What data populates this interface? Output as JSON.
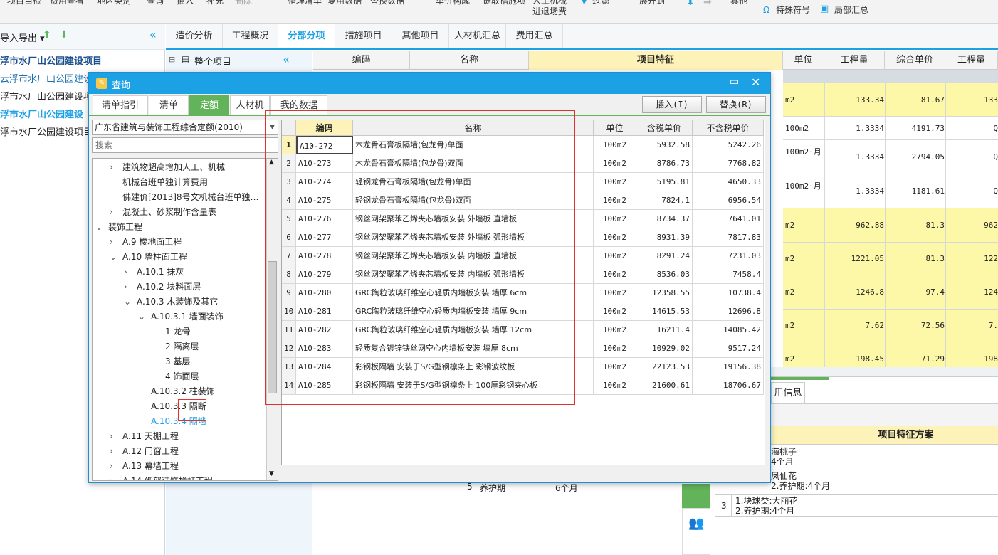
{
  "toolbar": {
    "items": [
      "项目自检",
      "费用查看",
      "地区类别",
      "查询",
      "插入",
      "补充",
      "删除",
      "整理清单",
      "复用数据",
      "替换数据",
      "单价构成",
      "提取措施项",
      "人工机械",
      "进退场费",
      "过滤",
      "展开到",
      "其他",
      "特殊符号",
      "局部汇总"
    ]
  },
  "left": {
    "import_export": "导入导出",
    "projects": [
      {
        "label": "浮市水厂山公园建设项目",
        "bold": true,
        "color": "#1a4f8c"
      },
      {
        "label": "云浮市水厂山公园建设",
        "bold": false,
        "color": "#1a6fb0"
      },
      {
        "label": "浮市水厂山公园建设项",
        "bold": false,
        "color": "#222"
      },
      {
        "label": "浮市水厂山公园建设",
        "bold": true,
        "color": "#1da1e5"
      },
      {
        "label": "浮市水厂公园建设项目",
        "bold": false,
        "color": "#222"
      }
    ]
  },
  "main_tabs": [
    "造价分析",
    "工程概况",
    "分部分项",
    "措施项目",
    "其他项目",
    "人材机汇总",
    "费用汇总"
  ],
  "active_main_tab": "分部分项",
  "midtree": {
    "root": "整个项目"
  },
  "main_header": [
    "编码",
    "名称",
    "项目特征",
    "单位",
    "工程量",
    "综合单价",
    "工程量"
  ],
  "main_rows": [
    {
      "unit": "m2",
      "qty": "133.34",
      "price": "81.67",
      "extra": "133",
      "hl": true
    },
    {
      "unit": "100m2",
      "qty": "1.3334",
      "price": "4191.73",
      "extra": "Q",
      "hl": false
    },
    {
      "unit": "100m2·月",
      "qty": "1.3334",
      "price": "2794.05",
      "extra": "Q",
      "hl": false
    },
    {
      "unit": "100m2·月",
      "qty": "1.3334",
      "price": "1181.61",
      "extra": "Q",
      "hl": false
    },
    {
      "unit": "m2",
      "qty": "962.88",
      "price": "81.3",
      "extra": "962",
      "hl": true
    },
    {
      "unit": "m2",
      "qty": "1221.05",
      "price": "81.3",
      "extra": "122",
      "hl": true
    },
    {
      "unit": "m2",
      "qty": "1246.8",
      "price": "97.4",
      "extra": "124",
      "hl": true
    },
    {
      "unit": "m2",
      "qty": "7.62",
      "price": "72.56",
      "extra": "7.",
      "hl": true
    },
    {
      "unit": "m2",
      "qty": "198.45",
      "price": "71.29",
      "extra": "198",
      "hl": true
    }
  ],
  "lower": {
    "tab_info": "用信息",
    "scheme_header": "项目特征方案",
    "frag1": "海桃子",
    "frag2": "4个月",
    "frag3": "凤仙花",
    "frag4": "2.养护期:4个月",
    "row3_no": "3",
    "row3_a": "1.块球类:大丽花",
    "row3_b": "2.养护期:4个月",
    "bottom_no": "5",
    "bottom_label": "养护期",
    "bottom_val": "6个月"
  },
  "dialog": {
    "title": "查询",
    "tabs": [
      "清单指引",
      "清单",
      "定额",
      "人材机",
      "我的数据"
    ],
    "active_tab": "定额",
    "insert_btn": "插入(I)",
    "replace_btn": "替换(R)",
    "quota_select": "广东省建筑与装饰工程综合定额(2010)",
    "search_placeholder": "搜索",
    "tree": [
      {
        "label": "建筑物超高增加人工、机械",
        "level": 1,
        "arrow": ">"
      },
      {
        "label": "机械台班单独计算费用",
        "level": 1,
        "arrow": ""
      },
      {
        "label": "佛建价[2013]8号文机械台班单独…",
        "level": 1,
        "arrow": ""
      },
      {
        "label": "混凝土、砂浆制作含量表",
        "level": 1,
        "arrow": ">"
      },
      {
        "label": "装饰工程",
        "level": 0,
        "arrow": "v"
      },
      {
        "label": "A.9 楼地面工程",
        "level": 1,
        "arrow": ">"
      },
      {
        "label": "A.10 墙柱面工程",
        "level": 1,
        "arrow": "v"
      },
      {
        "label": "A.10.1 抹灰",
        "level": 2,
        "arrow": ">"
      },
      {
        "label": "A.10.2 块料面层",
        "level": 2,
        "arrow": ">"
      },
      {
        "label": "A.10.3 木装饰及其它",
        "level": 2,
        "arrow": "v"
      },
      {
        "label": "A.10.3.1 墙面装饰",
        "level": 3,
        "arrow": "v"
      },
      {
        "label": "1 龙骨",
        "level": 4,
        "arrow": ""
      },
      {
        "label": "2 隔离层",
        "level": 4,
        "arrow": ""
      },
      {
        "label": "3 基层",
        "level": 4,
        "arrow": ""
      },
      {
        "label": "4 饰面层",
        "level": 4,
        "arrow": ""
      },
      {
        "label": "A.10.3.2 柱装饰",
        "level": 3,
        "arrow": ""
      },
      {
        "label": "A.10.3.3 隔断",
        "level": 3,
        "arrow": ""
      },
      {
        "label": "A.10.3.4 隔墙",
        "level": 3,
        "arrow": "",
        "selected": true
      },
      {
        "label": "A.11 天棚工程",
        "level": 1,
        "arrow": ">"
      },
      {
        "label": "A.12 门窗工程",
        "level": 1,
        "arrow": ">"
      },
      {
        "label": "A.13 幕墙工程",
        "level": 1,
        "arrow": ">"
      },
      {
        "label": "A.14 细部装饰栏杆工程",
        "level": 1,
        "arrow": ">"
      }
    ],
    "grid_headers": [
      "",
      "编码",
      "名称",
      "单位",
      "含税单价",
      "不含税单价"
    ],
    "grid_rows": [
      {
        "no": "1",
        "code": "A10-272",
        "name": "木龙骨石膏板隔墙(包龙骨)单面",
        "unit": "100m2",
        "p1": "5932.58",
        "p2": "5242.26"
      },
      {
        "no": "2",
        "code": "A10-273",
        "name": "木龙骨石膏板隔墙(包龙骨)双面",
        "unit": "100m2",
        "p1": "8786.73",
        "p2": "7768.82"
      },
      {
        "no": "3",
        "code": "A10-274",
        "name": "轻钢龙骨石膏板隔墙(包龙骨)单面",
        "unit": "100m2",
        "p1": "5195.81",
        "p2": "4650.33"
      },
      {
        "no": "4",
        "code": "A10-275",
        "name": "轻钢龙骨石膏板隔墙(包龙骨)双面",
        "unit": "100m2",
        "p1": "7824.1",
        "p2": "6956.54"
      },
      {
        "no": "5",
        "code": "A10-276",
        "name": "钢丝网架聚苯乙烯夹芯墙板安装 外墙板 直墙板",
        "unit": "100m2",
        "p1": "8734.37",
        "p2": "7641.01"
      },
      {
        "no": "6",
        "code": "A10-277",
        "name": "钢丝网架聚苯乙烯夹芯墙板安装 外墙板 弧形墙板",
        "unit": "100m2",
        "p1": "8931.39",
        "p2": "7817.83"
      },
      {
        "no": "7",
        "code": "A10-278",
        "name": "钢丝网架聚苯乙烯夹芯墙板安装 内墙板 直墙板",
        "unit": "100m2",
        "p1": "8291.24",
        "p2": "7231.03"
      },
      {
        "no": "8",
        "code": "A10-279",
        "name": "钢丝网架聚苯乙烯夹芯墙板安装 内墙板 弧形墙板",
        "unit": "100m2",
        "p1": "8536.03",
        "p2": "7458.4"
      },
      {
        "no": "9",
        "code": "A10-280",
        "name": "GRC陶粒玻璃纤维空心轻质内墙板安装 墙厚 6cm",
        "unit": "100m2",
        "p1": "12358.55",
        "p2": "10738.4"
      },
      {
        "no": "10",
        "code": "A10-281",
        "name": "GRC陶粒玻璃纤维空心轻质内墙板安装 墙厚 9cm",
        "unit": "100m2",
        "p1": "14615.53",
        "p2": "12696.8"
      },
      {
        "no": "11",
        "code": "A10-282",
        "name": "GRC陶粒玻璃纤维空心轻质内墙板安装 墙厚 12cm",
        "unit": "100m2",
        "p1": "16211.4",
        "p2": "14085.42"
      },
      {
        "no": "12",
        "code": "A10-283",
        "name": "轻质复合镀锌铁丝网空心内墙板安装 墙厚 8cm",
        "unit": "100m2",
        "p1": "10929.02",
        "p2": "9517.24"
      },
      {
        "no": "13",
        "code": "A10-284",
        "name": "彩钢板隔墙 安装于S/G型钢檩条上 彩钢波纹板",
        "unit": "100m2",
        "p1": "22123.53",
        "p2": "19156.38"
      },
      {
        "no": "14",
        "code": "A10-285",
        "name": "彩钢板隔墙 安装于S/G型钢檩条上 100厚彩钢夹心板",
        "unit": "100m2",
        "p1": "21600.61",
        "p2": "18706.67"
      }
    ]
  },
  "colors": {
    "accent": "#1da1e5",
    "green": "#62b35a",
    "highlight": "#fdf7a8",
    "red": "#e03030"
  }
}
